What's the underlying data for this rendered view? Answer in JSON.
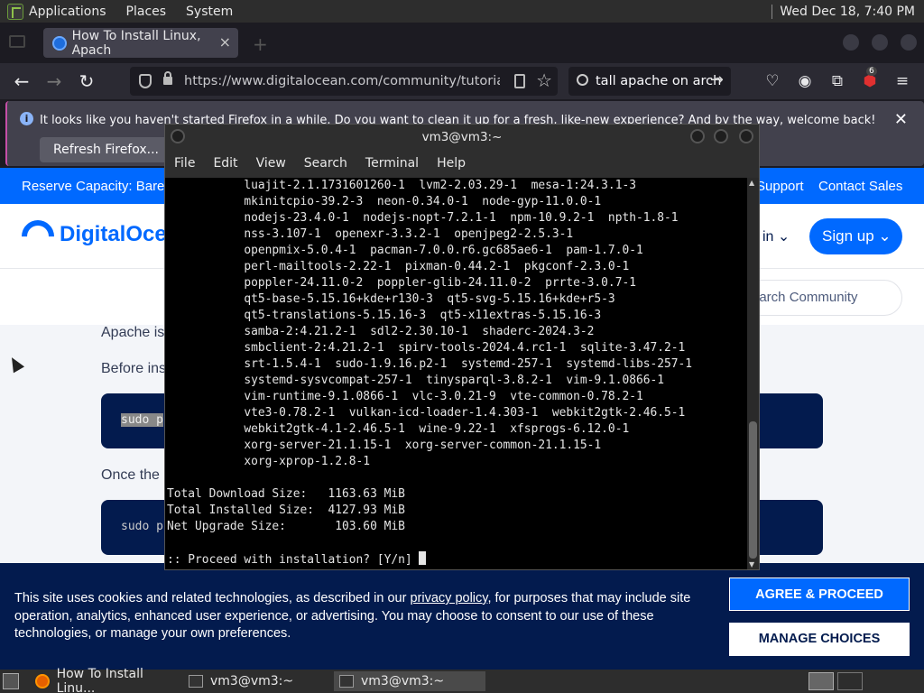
{
  "top_panel": {
    "menus": [
      "Applications",
      "Places",
      "System"
    ],
    "clock": "Wed Dec 18,  7:40 PM"
  },
  "firefox": {
    "tab_title": "How To Install Linux, Apach",
    "url": "https://www.digitalocean.com/community/tutorials/how",
    "search_text": "tall apache on arch",
    "notification": {
      "message": "It looks like you haven't started Firefox in a while. Do you want to clean it up for a fresh, like-new experience? And by the way, welcome back!",
      "button": "Refresh Firefox..."
    },
    "badge_count": "6",
    "icons": [
      "back-icon",
      "forward-icon",
      "reload-icon",
      "shield-icon",
      "lock-icon",
      "reader-icon",
      "star-icon",
      "search-icon",
      "pocket-icon",
      "account-icon",
      "extensions-icon",
      "ublock-icon",
      "menu-icon"
    ]
  },
  "page": {
    "promo_left": "Reserve Capacity: Bare",
    "promo_right": [
      "Support",
      "Contact Sales"
    ],
    "logo_text": "DigitalOce",
    "login_label": "in",
    "signup_label": "Sign up",
    "search_placeholder": "earch Community",
    "paragraphs": [
      "Apache is",
      "Before ins",
      "Once the"
    ],
    "code_lines": [
      "sudo p",
      "sudo p"
    ],
    "cookie": {
      "text_before_link": "This site uses cookies and related technologies, as described in our ",
      "link_text": "privacy policy",
      "text_after_link": ", for purposes that may include site operation, analytics, enhanced user experience, or advertising. You may choose to consent to our use of these technologies, or manage your own preferences.",
      "agree_label": "AGREE & PROCEED",
      "manage_label": "MANAGE CHOICES"
    },
    "colors": {
      "brand": "#0069ff",
      "navy": "#031b4e"
    }
  },
  "terminal": {
    "title": "vm3@vm3:~",
    "menu": [
      "File",
      "Edit",
      "View",
      "Search",
      "Terminal",
      "Help"
    ],
    "lines": [
      "           luajit-2.1.1731601260-1  lvm2-2.03.29-1  mesa-1:24.3.1-3",
      "           mkinitcpio-39.2-3  neon-0.34.0-1  node-gyp-11.0.0-1",
      "           nodejs-23.4.0-1  nodejs-nopt-7.2.1-1  npm-10.9.2-1  npth-1.8-1",
      "           nss-3.107-1  openexr-3.3.2-1  openjpeg2-2.5.3-1",
      "           openpmix-5.0.4-1  pacman-7.0.0.r6.gc685ae6-1  pam-1.7.0-1",
      "           perl-mailtools-2.22-1  pixman-0.44.2-1  pkgconf-2.3.0-1",
      "           poppler-24.11.0-2  poppler-glib-24.11.0-2  prrte-3.0.7-1",
      "           qt5-base-5.15.16+kde+r130-3  qt5-svg-5.15.16+kde+r5-3",
      "           qt5-translations-5.15.16-3  qt5-x11extras-5.15.16-3",
      "           samba-2:4.21.2-1  sdl2-2.30.10-1  shaderc-2024.3-2",
      "           smbclient-2:4.21.2-1  spirv-tools-2024.4.rc1-1  sqlite-3.47.2-1",
      "           srt-1.5.4-1  sudo-1.9.16.p2-1  systemd-257-1  systemd-libs-257-1",
      "           systemd-sysvcompat-257-1  tinysparql-3.8.2-1  vim-9.1.0866-1",
      "           vim-runtime-9.1.0866-1  vlc-3.0.21-9  vte-common-0.78.2-1",
      "           vte3-0.78.2-1  vulkan-icd-loader-1.4.303-1  webkit2gtk-2.46.5-1",
      "           webkit2gtk-4.1-2.46.5-1  wine-9.22-1  xfsprogs-6.12.0-1",
      "           xorg-server-21.1.15-1  xorg-server-common-21.1.15-1",
      "           xorg-xprop-1.2.8-1",
      "",
      "Total Download Size:   1163.63 MiB",
      "Total Installed Size:  4127.93 MiB",
      "Net Upgrade Size:       103.60 MiB",
      "",
      ":: Proceed with installation? [Y/n] "
    ]
  },
  "taskbar": {
    "tasks": [
      "How To Install Linu...",
      "vm3@vm3:~",
      "vm3@vm3:~"
    ]
  }
}
